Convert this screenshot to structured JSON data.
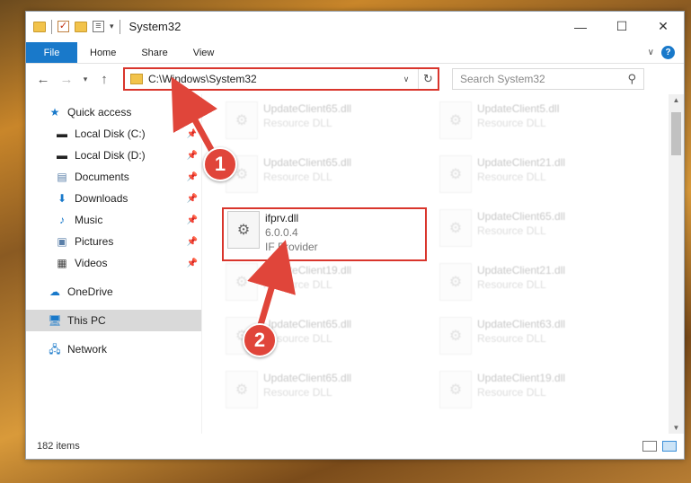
{
  "window": {
    "title": "System32"
  },
  "ribbon": {
    "file": "File",
    "tabs": [
      "Home",
      "Share",
      "View"
    ],
    "help": "?"
  },
  "address": {
    "path": "C:\\Windows\\System32",
    "search_placeholder": "Search System32"
  },
  "sidebar": {
    "items": [
      {
        "label": "Quick access",
        "icon": "star-icon",
        "level": 1
      },
      {
        "label": "Local Disk (C:)",
        "icon": "drive-icon",
        "level": 2,
        "pinned": true
      },
      {
        "label": "Local Disk (D:)",
        "icon": "drive-icon",
        "level": 2,
        "pinned": true
      },
      {
        "label": "Documents",
        "icon": "documents-icon",
        "level": 2,
        "pinned": true
      },
      {
        "label": "Downloads",
        "icon": "download-icon",
        "level": 2,
        "pinned": true
      },
      {
        "label": "Music",
        "icon": "music-icon",
        "level": 2,
        "pinned": true
      },
      {
        "label": "Pictures",
        "icon": "pictures-icon",
        "level": 2,
        "pinned": true
      },
      {
        "label": "Videos",
        "icon": "videos-icon",
        "level": 2,
        "pinned": true
      },
      {
        "label": "OneDrive",
        "icon": "cloud-icon",
        "level": 1
      },
      {
        "label": "This PC",
        "icon": "computer-icon",
        "level": 1,
        "selected": true
      },
      {
        "label": "Network",
        "icon": "network-icon",
        "level": 1
      }
    ]
  },
  "files": {
    "left": [
      {
        "name": "UpdateClient65.dll",
        "sub": "Resource DLL"
      },
      {
        "name": "UpdateClient65.dll",
        "sub": "Resource DLL"
      },
      {
        "name": "UpdateClient19.dll",
        "sub": "Resource DLL"
      },
      {
        "name": "UpdateClient65.dll",
        "sub": "Resource DLL"
      },
      {
        "name": "UpdateClient65.dll",
        "sub": "Resource DLL"
      }
    ],
    "right": [
      {
        "name": "UpdateClient5.dll",
        "sub": "Resource DLL"
      },
      {
        "name": "UpdateClient21.dll",
        "sub": "Resource DLL"
      },
      {
        "name": "UpdateClient65.dll",
        "sub": "Resource DLL"
      },
      {
        "name": "UpdateClient21.dll",
        "sub": "Resource DLL"
      },
      {
        "name": "UpdateClient63.dll",
        "sub": "Resource DLL"
      },
      {
        "name": "UpdateClient19.dll",
        "sub": "Resource DLL"
      }
    ],
    "highlight": {
      "name": "ifprv.dll",
      "version": "6.0.0.4",
      "desc": "IF Provider"
    }
  },
  "status": {
    "count": "182 items"
  },
  "callouts": {
    "one": "1",
    "two": "2"
  },
  "colors": {
    "accent": "#1979ca",
    "highlight": "#d9352c",
    "callout": "#e0453a"
  }
}
